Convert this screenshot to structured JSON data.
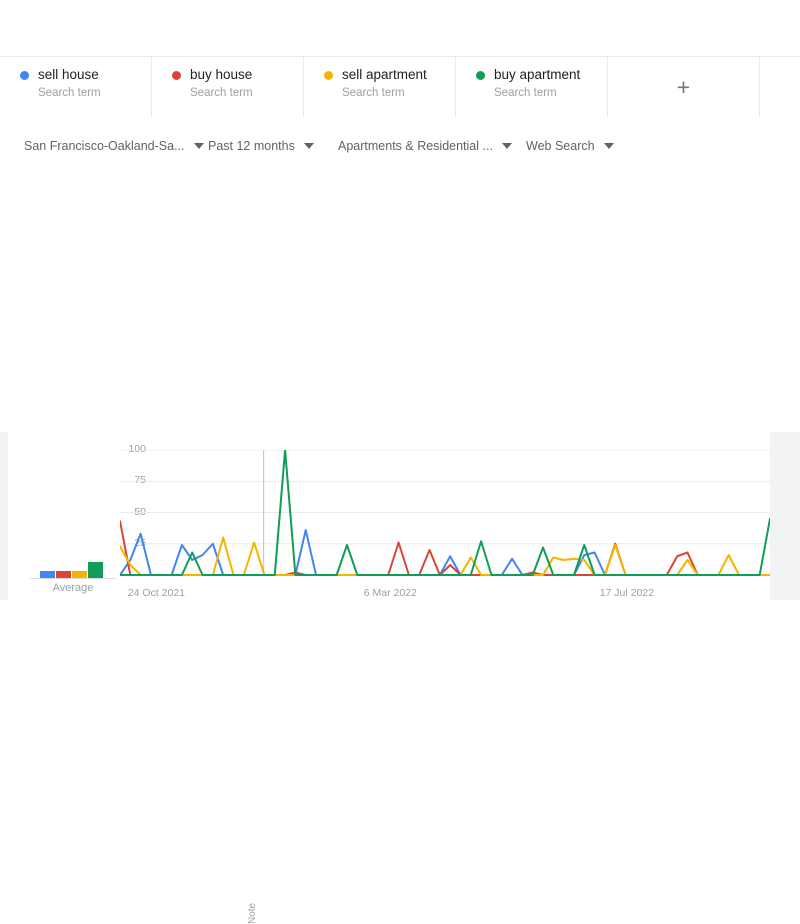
{
  "terms": {
    "cards": [
      {
        "label": "sell house",
        "sublabel": "Search term",
        "color": "#4285F4"
      },
      {
        "label": "buy house",
        "sublabel": "Search term",
        "color": "#DB4437"
      },
      {
        "label": "sell apartment",
        "sublabel": "Search term",
        "color": "#F4B400"
      },
      {
        "label": "buy apartment",
        "sublabel": "Search term",
        "color": "#0F9D58"
      }
    ],
    "add_label": "+"
  },
  "filters": [
    {
      "name": "location",
      "label": "San Francisco-Oakland-Sa..."
    },
    {
      "name": "time",
      "label": "Past 12 months"
    },
    {
      "name": "category",
      "label": "Apartments & Residential ..."
    },
    {
      "name": "type",
      "label": "Web Search"
    }
  ],
  "chart_panel": {
    "average_widget": {
      "label": "Average",
      "bars": [
        {
          "series": "sell house",
          "color": "#4285F4",
          "value": 5
        },
        {
          "series": "buy house",
          "color": "#DB4437",
          "value": 5
        },
        {
          "series": "sell apartment",
          "color": "#F4B400",
          "value": 5
        },
        {
          "series": "buy apartment",
          "color": "#0F9D58",
          "value": 12
        }
      ]
    },
    "note_marker": {
      "label": "Note",
      "x_fraction": 0.221
    }
  },
  "chart_data": {
    "type": "line",
    "title": "",
    "xlabel": "",
    "ylabel": "",
    "ylim": [
      0,
      100
    ],
    "yticks": [
      0,
      25,
      50,
      75,
      100
    ],
    "ytick_labels": [
      "",
      "25",
      "50",
      "75",
      "100"
    ],
    "grid": true,
    "legend_position": "top",
    "xtick_labels": [
      "24 Oct 2021",
      "6 Mar 2022",
      "17 Jul 2022"
    ],
    "xtick_fractions": [
      0.012,
      0.375,
      0.738
    ],
    "annotations": [
      {
        "text": "Note",
        "x_fraction": 0.221
      }
    ],
    "series": [
      {
        "name": "sell house",
        "color": "#4285F4",
        "values": [
          0,
          12,
          33,
          0,
          0,
          0,
          24,
          12,
          16,
          25,
          0,
          0,
          0,
          0,
          0,
          0,
          0,
          0,
          36,
          0,
          0,
          0,
          0,
          0,
          0,
          0,
          0,
          0,
          0,
          0,
          0,
          0,
          15,
          0,
          0,
          0,
          0,
          0,
          13,
          0,
          0,
          0,
          0,
          0,
          0,
          16,
          18,
          0,
          0,
          0,
          0,
          0,
          0,
          0,
          0,
          0,
          0,
          0,
          0,
          0,
          0,
          0,
          0,
          0
        ]
      },
      {
        "name": "buy house",
        "color": "#DB4437",
        "values": [
          43,
          0,
          0,
          0,
          0,
          0,
          0,
          0,
          0,
          0,
          0,
          0,
          0,
          0,
          0,
          0,
          0,
          2,
          0,
          0,
          0,
          0,
          0,
          0,
          0,
          0,
          0,
          26,
          0,
          0,
          20,
          0,
          8,
          0,
          0,
          0,
          0,
          0,
          0,
          0,
          2,
          0,
          0,
          0,
          0,
          0,
          0,
          0,
          25,
          0,
          0,
          0,
          0,
          0,
          15,
          18,
          0,
          0,
          0,
          0,
          0,
          0,
          0,
          0
        ]
      },
      {
        "name": "sell apartment",
        "color": "#F4B400",
        "values": [
          23,
          8,
          0,
          0,
          0,
          0,
          0,
          0,
          0,
          0,
          30,
          0,
          0,
          26,
          0,
          0,
          0,
          0,
          0,
          0,
          0,
          0,
          0,
          0,
          0,
          0,
          0,
          0,
          0,
          0,
          0,
          0,
          0,
          0,
          14,
          0,
          0,
          0,
          0,
          0,
          0,
          0,
          14,
          12,
          13,
          12,
          0,
          0,
          24,
          0,
          0,
          0,
          0,
          0,
          0,
          12,
          0,
          0,
          0,
          16,
          0,
          0,
          0,
          0
        ]
      },
      {
        "name": "buy apartment",
        "color": "#0F9D58",
        "values": [
          0,
          0,
          0,
          0,
          0,
          0,
          0,
          18,
          0,
          0,
          0,
          0,
          0,
          0,
          0,
          0,
          100,
          0,
          0,
          0,
          0,
          0,
          24,
          0,
          0,
          0,
          0,
          0,
          0,
          0,
          0,
          0,
          0,
          0,
          0,
          27,
          0,
          0,
          0,
          0,
          0,
          22,
          0,
          0,
          0,
          24,
          0,
          0,
          0,
          0,
          0,
          0,
          0,
          0,
          0,
          0,
          0,
          0,
          0,
          0,
          0,
          0,
          0,
          45
        ]
      }
    ]
  }
}
